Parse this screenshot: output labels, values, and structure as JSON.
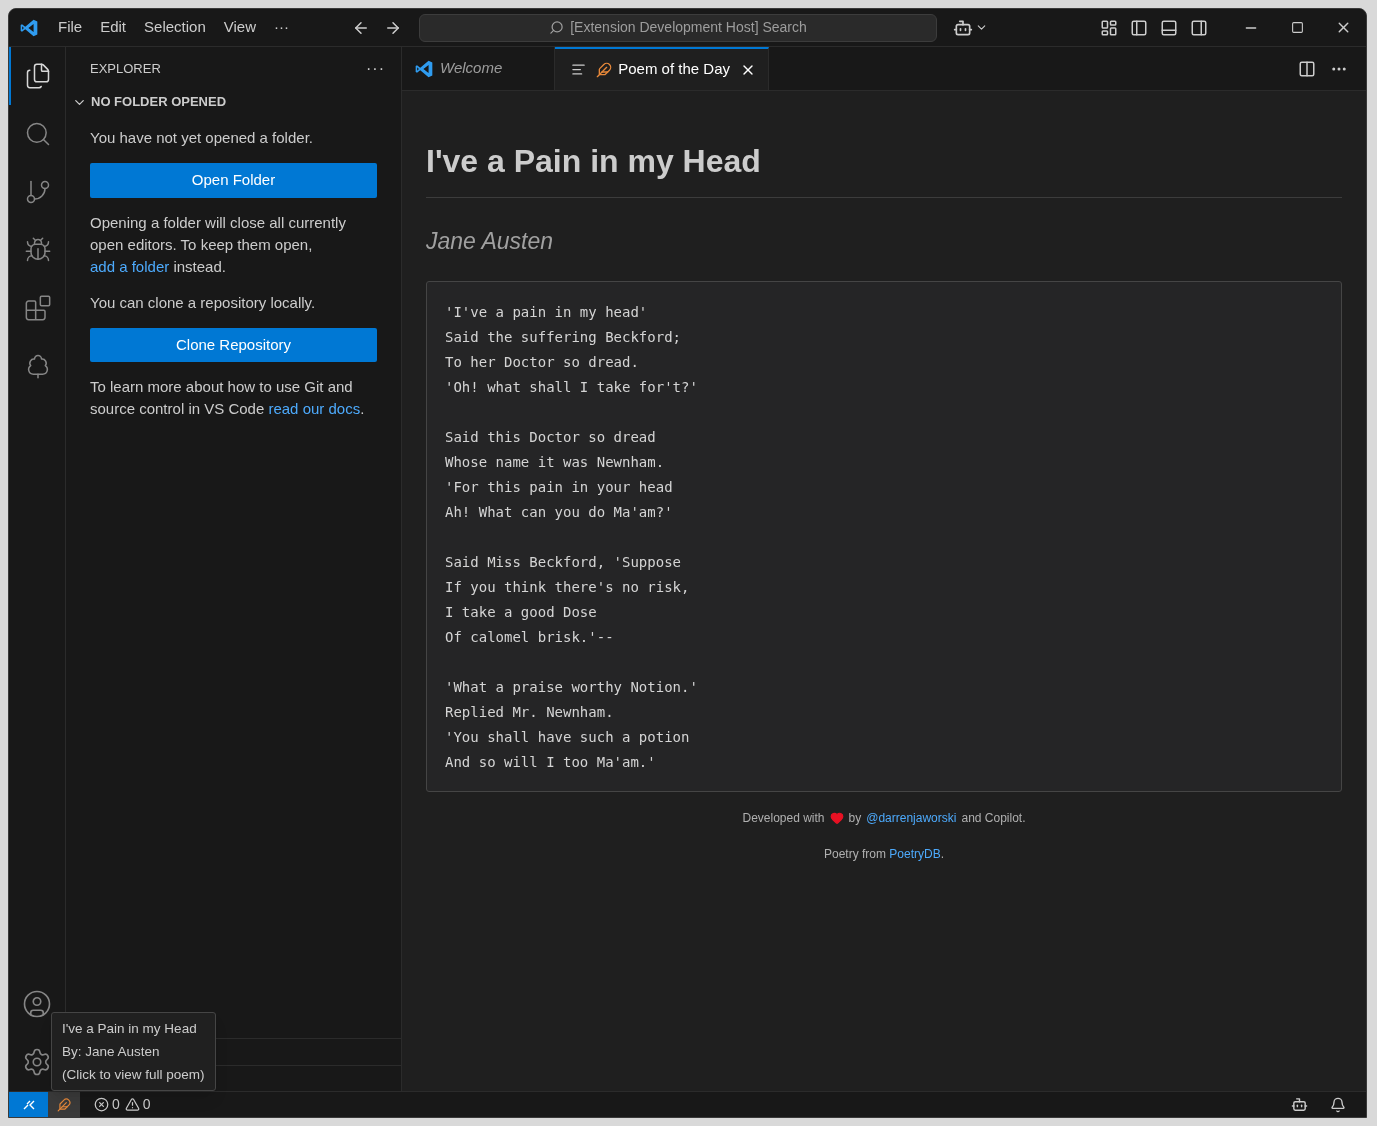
{
  "menu": [
    "File",
    "Edit",
    "Selection",
    "View",
    "···"
  ],
  "command_center": {
    "placeholder": "[Extension Development Host] Search"
  },
  "activity_bar": [
    {
      "kind": "files",
      "selected": true
    },
    {
      "kind": "search",
      "selected": false
    },
    {
      "kind": "branch",
      "selected": false
    },
    {
      "kind": "run",
      "selected": false
    },
    {
      "kind": "extensions",
      "selected": false
    },
    {
      "kind": "tree",
      "selected": false
    }
  ],
  "sidebar": {
    "title": "EXPLORER",
    "more": "···",
    "section": {
      "title": "NO FOLDER OPENED",
      "expanded": true
    },
    "blocks": [
      {
        "kind": "text",
        "parts": [
          {
            "text": "You have not yet opened a folder."
          }
        ]
      },
      {
        "kind": "button",
        "label": "Open Folder"
      },
      {
        "kind": "text",
        "parts": [
          {
            "text": "Opening a folder will close all currently open editors. To keep them open, "
          },
          {
            "link": "add a folder"
          },
          {
            "text": " instead."
          }
        ]
      },
      {
        "kind": "text",
        "parts": [
          {
            "text": "You can clone a repository locally."
          }
        ]
      },
      {
        "kind": "button",
        "label": "Clone Repository"
      },
      {
        "kind": "text",
        "parts": [
          {
            "text": "To learn more about how to use Git and source control in VS Code "
          },
          {
            "link": "read our docs"
          },
          {
            "text": "."
          }
        ]
      }
    ]
  },
  "tabs": [
    {
      "label": "Welcome",
      "kind": "welcome",
      "selected": false,
      "preview": true
    },
    {
      "label": "Poem of the Day",
      "kind": "poem",
      "selected": true,
      "preview": false
    }
  ],
  "poem": {
    "title": "I've a Pain in my Head",
    "author": "Jane Austen",
    "stanzas": [
      [
        "'I've a pain in my head'",
        "Said the suffering Beckford;",
        "To her Doctor so dread.",
        "'Oh! what shall I take for't?'"
      ],
      [
        "Said this Doctor so dread",
        "Whose name it was Newnham.",
        "'For this pain in your head",
        "Ah! What can you do Ma'am?'"
      ],
      [
        "Said Miss Beckford, 'Suppose",
        "If you think there's no risk,",
        "I take a good Dose",
        "Of calomel brisk.'--"
      ],
      [
        "'What a praise worthy Notion.'",
        "Replied Mr. Newnham.",
        "'You shall have such a potion",
        "And so will I too Ma'am.'"
      ]
    ],
    "credit": {
      "before": "Developed with",
      "middle": "by",
      "link": "@darrenjaworski",
      "after": "and Copilot."
    },
    "source": {
      "before": "Poetry from",
      "link": "PoetryDB",
      "after": "."
    }
  },
  "tooltip": [
    "I've a Pain in my Head",
    "By: Jane Austen",
    "(Click to view full poem)"
  ],
  "status_bar": {
    "errors": "0",
    "warnings": "0"
  }
}
